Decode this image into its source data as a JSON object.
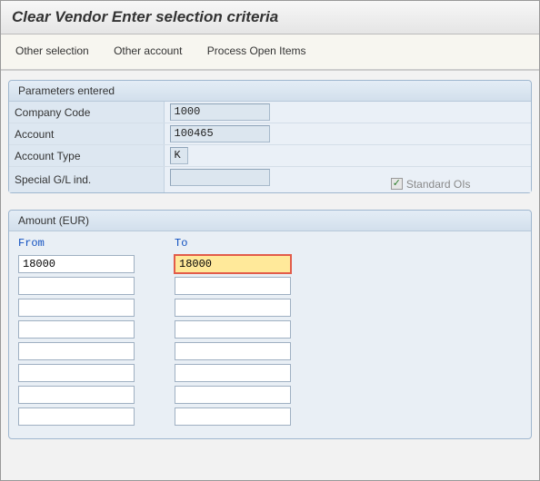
{
  "title": "Clear Vendor Enter selection criteria",
  "menu": {
    "other_selection": "Other selection",
    "other_account": "Other account",
    "process_open_items": "Process Open Items"
  },
  "params_panel": {
    "header": "Parameters entered",
    "rows": {
      "company_code": {
        "label": "Company Code",
        "value": "1000"
      },
      "account": {
        "label": "Account",
        "value": "100465"
      },
      "account_type": {
        "label": "Account Type",
        "value": "K"
      },
      "special_gl": {
        "label": "Special G/L ind.",
        "value": ""
      }
    },
    "standard_ois": {
      "label": "Standard OIs",
      "checked": true
    }
  },
  "amount_panel": {
    "header": "Amount (EUR)",
    "columns": {
      "from": "From",
      "to": "To"
    },
    "rows": [
      {
        "from": "18000",
        "to": "18000",
        "to_active": true
      },
      {
        "from": "",
        "to": ""
      },
      {
        "from": "",
        "to": ""
      },
      {
        "from": "",
        "to": ""
      },
      {
        "from": "",
        "to": ""
      },
      {
        "from": "",
        "to": ""
      },
      {
        "from": "",
        "to": ""
      },
      {
        "from": "",
        "to": ""
      }
    ]
  }
}
